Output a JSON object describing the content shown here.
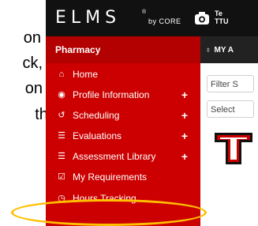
{
  "document": {
    "line1": "on",
    "line2": "ck,",
    "line3": "on",
    "line4": "the"
  },
  "header": {
    "logo": "ELMS",
    "logo_sub": "by CORE",
    "user_line1": "Te",
    "user_line2": "TTU"
  },
  "sidebar": {
    "header": "Pharmacy",
    "items": [
      {
        "label": "Home",
        "icon": "home-icon",
        "expandable": false
      },
      {
        "label": "Profile Information",
        "icon": "profile-icon",
        "expandable": true
      },
      {
        "label": "Scheduling",
        "icon": "history-icon",
        "expandable": true
      },
      {
        "label": "Evaluations",
        "icon": "list-icon",
        "expandable": true
      },
      {
        "label": "Assessment Library",
        "icon": "list-icon",
        "expandable": true
      },
      {
        "label": "My Requirements",
        "icon": "checkbox-icon",
        "expandable": false
      },
      {
        "label": "Hours Tracking",
        "icon": "clock-icon",
        "expandable": false
      }
    ],
    "plus": "+"
  },
  "right_pane": {
    "head_label": "MY A",
    "filter_placeholder": "Filter S",
    "select_label": "Select"
  },
  "colors": {
    "sidebar_bg": "#cc0000",
    "topbar_bg": "#111111",
    "highlight": "#ffc000"
  }
}
